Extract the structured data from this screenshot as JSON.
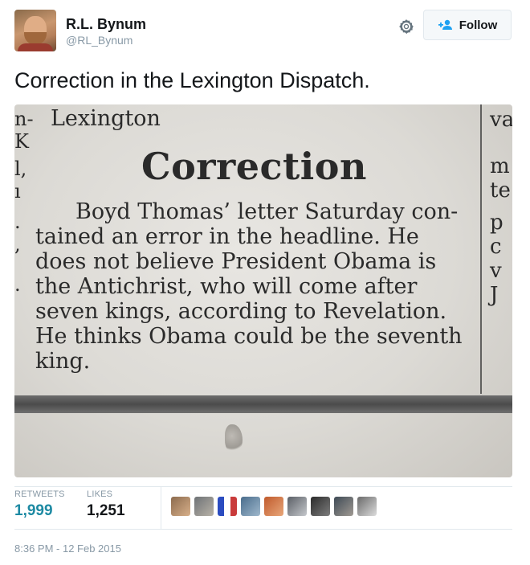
{
  "author": {
    "full_name": "R.L. Bynum",
    "handle": "@RL_Bynum"
  },
  "actions": {
    "follow_label": "Follow"
  },
  "tweet": {
    "text": "Correction in the Lexington Dispatch."
  },
  "media": {
    "masthead": "Lexington",
    "left_fragment": [
      "n-",
      "K",
      "l,",
      "ı",
      ".",
      ",",
      "."
    ],
    "right_fragment": [
      "va",
      "m",
      "te",
      "p",
      "c",
      "v",
      "J"
    ],
    "heading": "Correction",
    "body_lines": [
      "Boyd Thomas’ letter Saturday con-",
      "tained an error in the headline. He",
      "does not believe President Obama is",
      "the Antichrist, who will come after",
      "seven kings, according to Revelation.",
      "He thinks Obama could be the seventh",
      "king."
    ]
  },
  "stats": {
    "retweets_label": "RETWEETS",
    "retweets_value": "1,999",
    "likes_label": "LIKES",
    "likes_value": "1,251"
  },
  "likers": [
    {
      "icon": "avatar-1",
      "color": "#8c6b4e"
    },
    {
      "icon": "avatar-2",
      "color": "#6e7276"
    },
    {
      "icon": "avatar-3",
      "color": "#c93b3b"
    },
    {
      "icon": "avatar-4",
      "color": "#4a6d8c"
    },
    {
      "icon": "avatar-5",
      "color": "#c05a2c"
    },
    {
      "icon": "avatar-6",
      "color": "#5b5f66"
    },
    {
      "icon": "avatar-7",
      "color": "#2b2b2b"
    },
    {
      "icon": "avatar-8",
      "color": "#3e4a55"
    },
    {
      "icon": "avatar-9",
      "color": "#6a6a6a"
    }
  ],
  "timestamp": "8:36 PM - 12 Feb 2015",
  "colors": {
    "accent": "#1da1f2",
    "muted": "#8899a6",
    "border": "#e1e8ed"
  }
}
